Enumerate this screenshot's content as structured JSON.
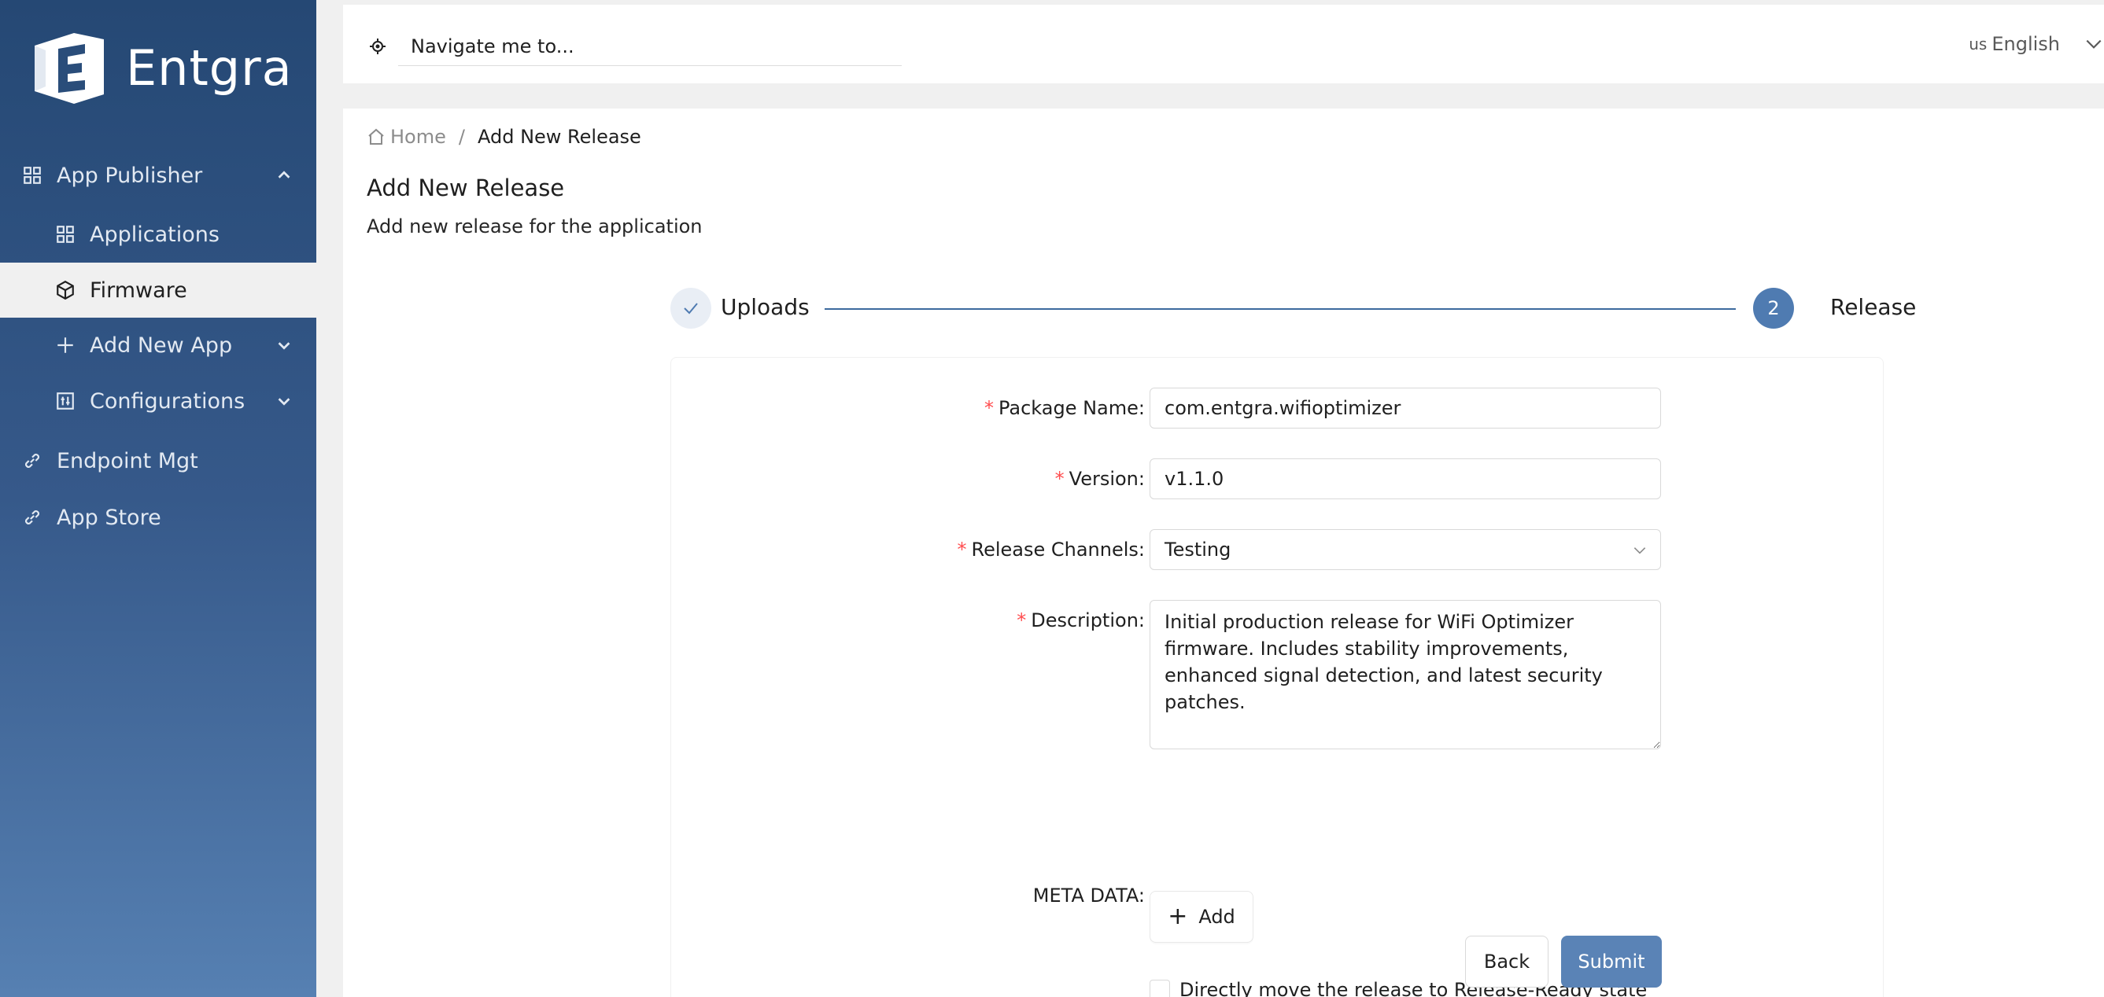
{
  "brand": {
    "name": "Entgra"
  },
  "sidebar": {
    "items": [
      {
        "label": "App Publisher",
        "icon": "grid-icon",
        "expanded": true
      },
      {
        "label": "Applications",
        "icon": "grid-icon"
      },
      {
        "label": "Firmware",
        "icon": "cube-icon",
        "active": true
      },
      {
        "label": "Add New App",
        "icon": "plus-icon"
      },
      {
        "label": "Configurations",
        "icon": "sliders-icon"
      },
      {
        "label": "Endpoint Mgt",
        "icon": "link-icon"
      },
      {
        "label": "App Store",
        "icon": "link-icon"
      }
    ]
  },
  "header": {
    "search_placeholder": "Navigate me to...",
    "language": {
      "flag": "us",
      "label": "English"
    }
  },
  "breadcrumb": {
    "home": "Home",
    "separator": "/",
    "current": "Add New Release"
  },
  "page": {
    "title": "Add New Release",
    "subtitle": "Add new release for the application"
  },
  "steps": [
    {
      "label": "Uploads",
      "status": "done"
    },
    {
      "number": "2",
      "label": "Release",
      "status": "current"
    }
  ],
  "form": {
    "package_name": {
      "label": "Package Name",
      "value": "com.entgra.wifioptimizer"
    },
    "version": {
      "label": "Version",
      "value": "v1.1.0"
    },
    "release_channels": {
      "label": "Release Channels",
      "value": "Testing"
    },
    "description": {
      "label": "Description",
      "value": "Initial production release for WiFi Optimizer firmware. Includes stability improvements, enhanced signal detection, and latest security patches."
    },
    "meta_data": {
      "label": "META DATA",
      "add_label": "Add"
    },
    "release_ready_checkbox": {
      "label": "Directly move the release to Release-Ready state",
      "checked": false
    },
    "back_label": "Back",
    "submit_label": "Submit",
    "label_suffix": ":",
    "required_mark": "*"
  },
  "colors": {
    "sidebar_top": "#254874",
    "sidebar_bottom": "#5680b2",
    "primary": "#5a83b6",
    "step_line": "#3c6a9e",
    "required": "#ff4d4f"
  }
}
